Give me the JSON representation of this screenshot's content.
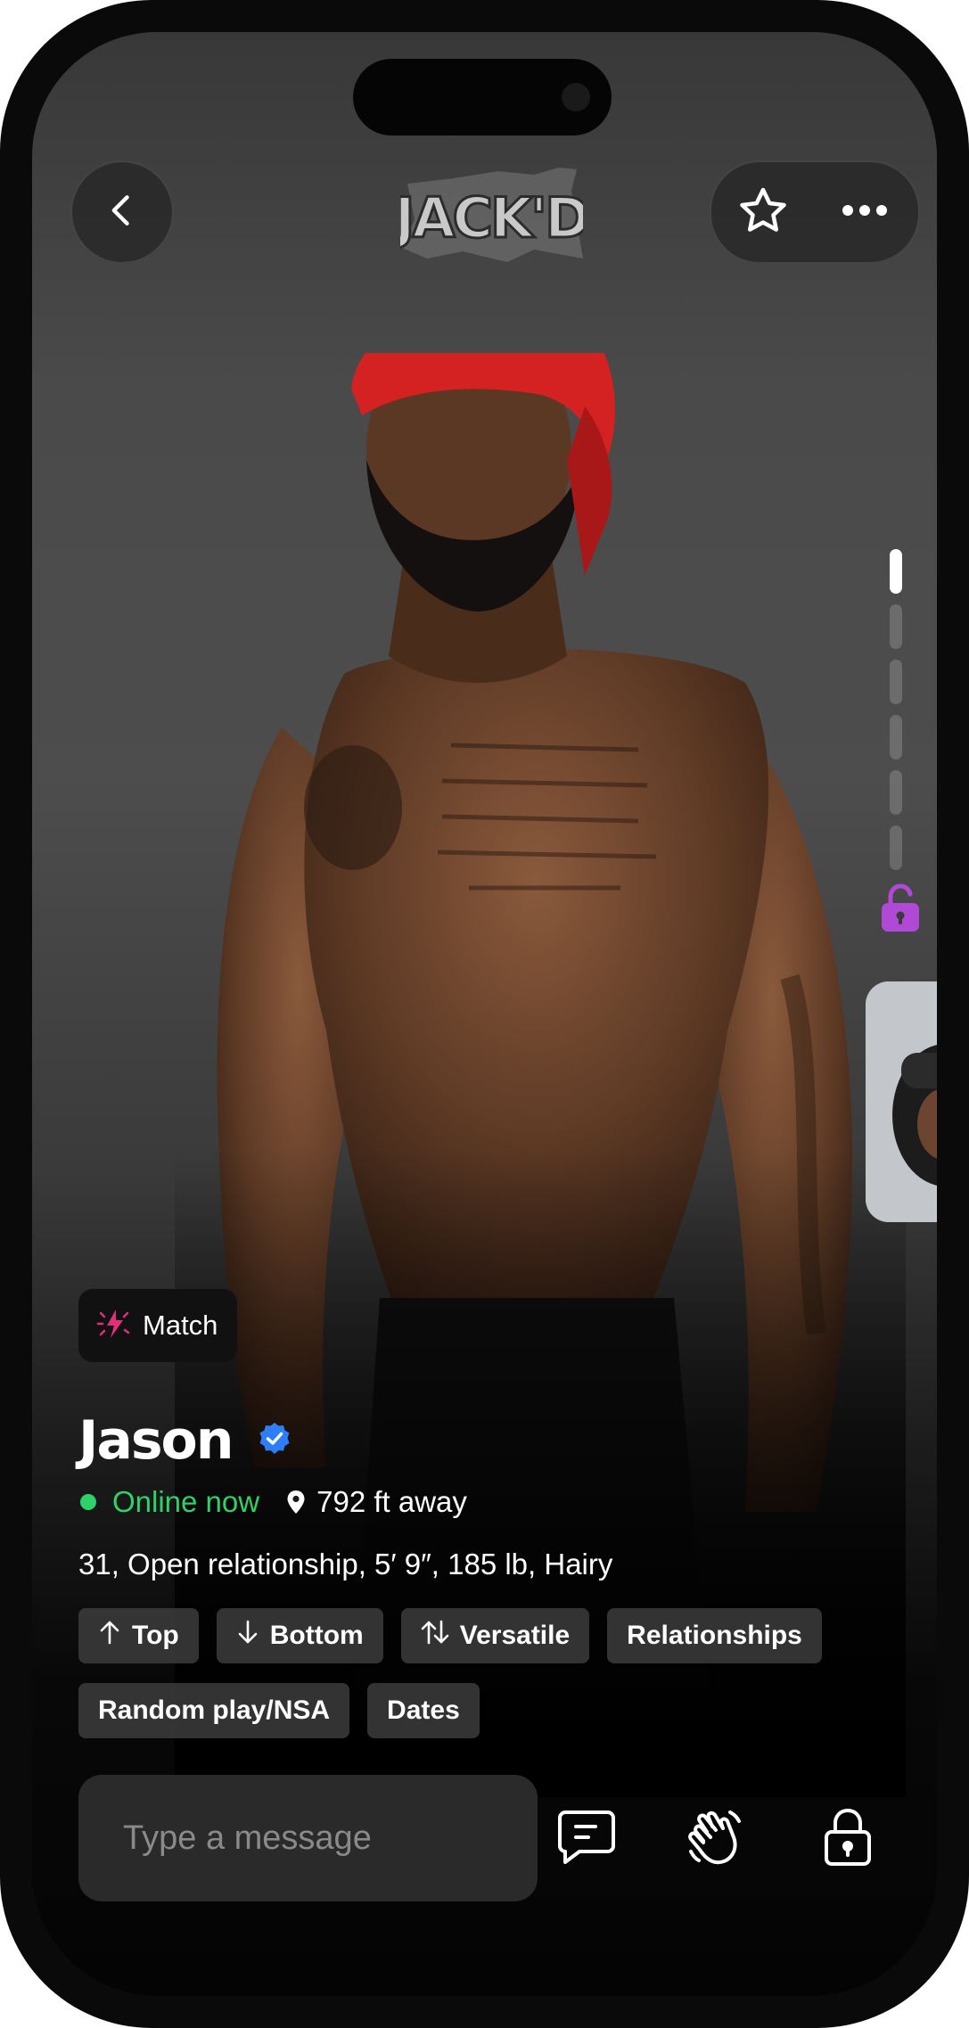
{
  "header": {
    "back_icon": "chevron-left-icon",
    "logo_text": "JACK'D",
    "favorite_icon": "star-icon",
    "more_icon": "more-horizontal-icon"
  },
  "gallery": {
    "photo_count": 6,
    "current_index": 1,
    "locked_icon": "unlock-icon",
    "accent_color": "#b049d6"
  },
  "profile": {
    "badge_icon": "match-sparkle-icon",
    "badge_label": "Match",
    "name": "Jason",
    "verified_icon": "verified-check-icon",
    "verified_color": "#2d7ff9",
    "status": "Online now",
    "status_color": "#2ed16a",
    "location_icon": "location-pin-icon",
    "distance": "792 ft away",
    "details": "31, Open relationship, 5′ 9″, 185 lb, Hairy",
    "tags": [
      {
        "label": "Top",
        "icon": "arrow-up-icon"
      },
      {
        "label": "Bottom",
        "icon": "arrow-down-icon"
      },
      {
        "label": "Versatile",
        "icon": "arrows-up-down-icon"
      },
      {
        "label": "Relationships",
        "icon": ""
      },
      {
        "label": "Random play/NSA",
        "icon": ""
      },
      {
        "label": "Dates",
        "icon": ""
      }
    ]
  },
  "composer": {
    "placeholder": "Type a message",
    "chat_icon": "chat-bubble-icon",
    "wave_icon": "wave-hand-icon",
    "lock_icon": "lock-icon"
  }
}
